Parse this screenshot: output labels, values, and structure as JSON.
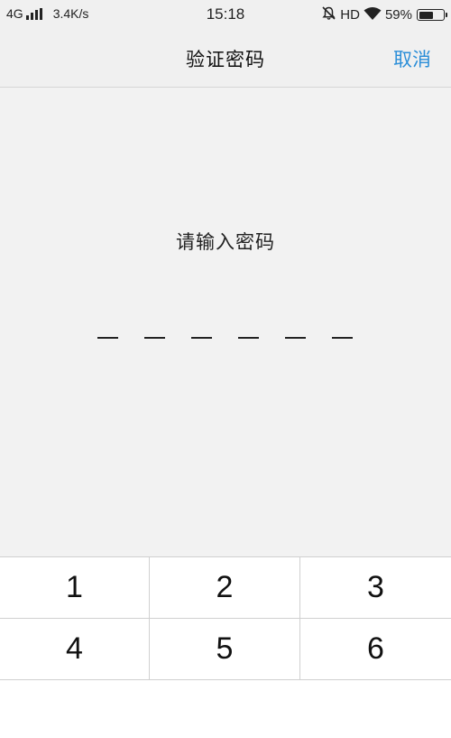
{
  "status_bar": {
    "network": "4G",
    "speed": "3.4K/s",
    "time": "15:18",
    "hd": "HD",
    "battery_text": "59%",
    "battery_level": 0.59
  },
  "nav": {
    "title": "验证密码",
    "cancel": "取消"
  },
  "prompt": "请输入密码",
  "pin_length": 6,
  "keypad": {
    "keys": [
      "1",
      "2",
      "3",
      "4",
      "5",
      "6"
    ]
  },
  "colors": {
    "accent": "#2b8ed8",
    "background": "#f2f2f2",
    "keypad_bg": "#ffffff"
  }
}
